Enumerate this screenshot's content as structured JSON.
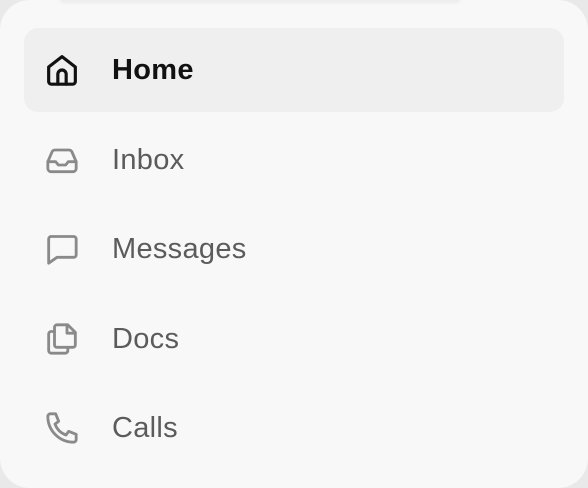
{
  "sidebar": {
    "items": [
      {
        "label": "Home",
        "icon": "home-icon",
        "active": true
      },
      {
        "label": "Inbox",
        "icon": "inbox-icon",
        "active": false
      },
      {
        "label": "Messages",
        "icon": "message-icon",
        "active": false
      },
      {
        "label": "Docs",
        "icon": "docs-icon",
        "active": false
      },
      {
        "label": "Calls",
        "icon": "phone-icon",
        "active": false
      }
    ]
  },
  "colors": {
    "panel_background": "#f8f8f8",
    "active_background": "#efefef",
    "active_text": "#111111",
    "inactive_text": "#5b5b5b",
    "inactive_icon": "#8a8a8a"
  }
}
